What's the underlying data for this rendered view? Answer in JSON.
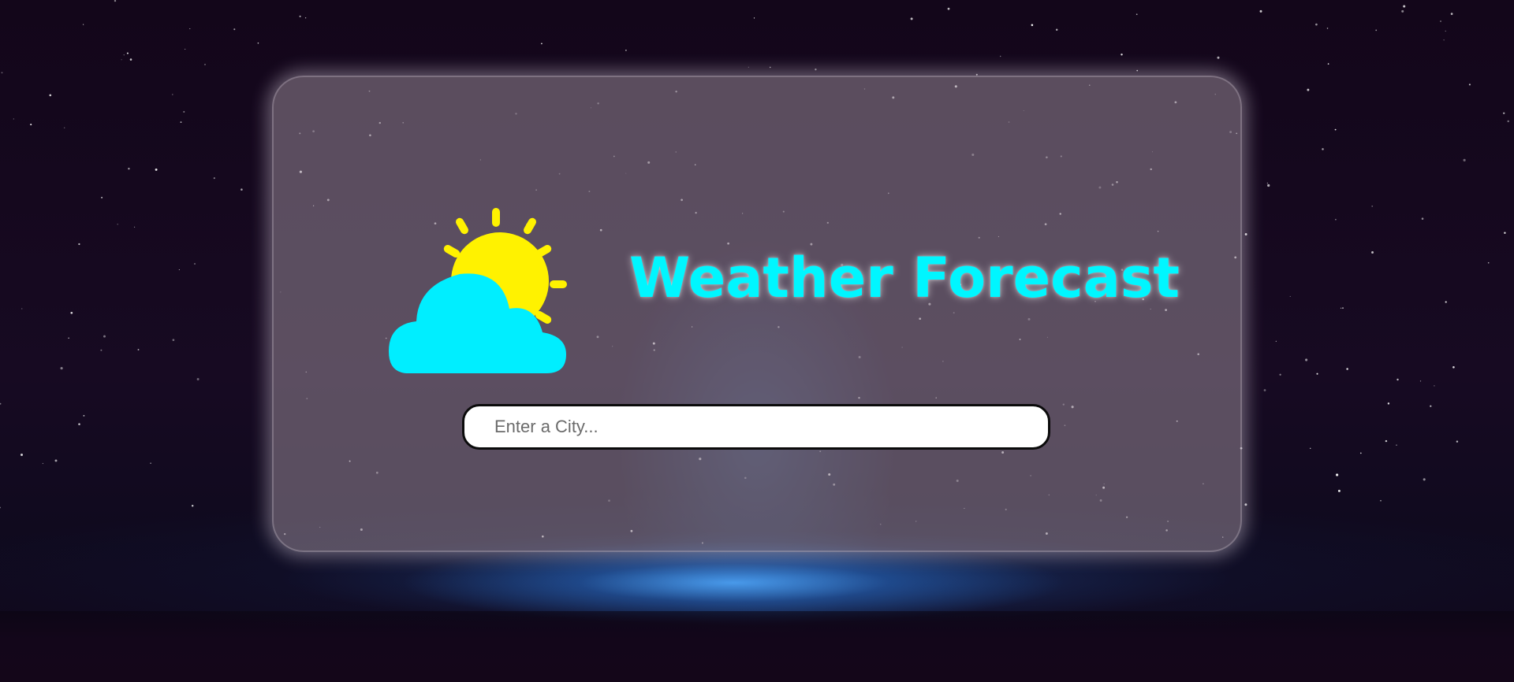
{
  "app": {
    "title": "Weather Forecast"
  },
  "search": {
    "placeholder": "Enter a City...",
    "value": ""
  },
  "icons": {
    "logo": "sun-behind-cloud-icon"
  },
  "colors": {
    "title": "#00f6ff",
    "sun": "#fff200",
    "cloud": "#00eeff",
    "background": "#14061a",
    "card": "#968796"
  }
}
